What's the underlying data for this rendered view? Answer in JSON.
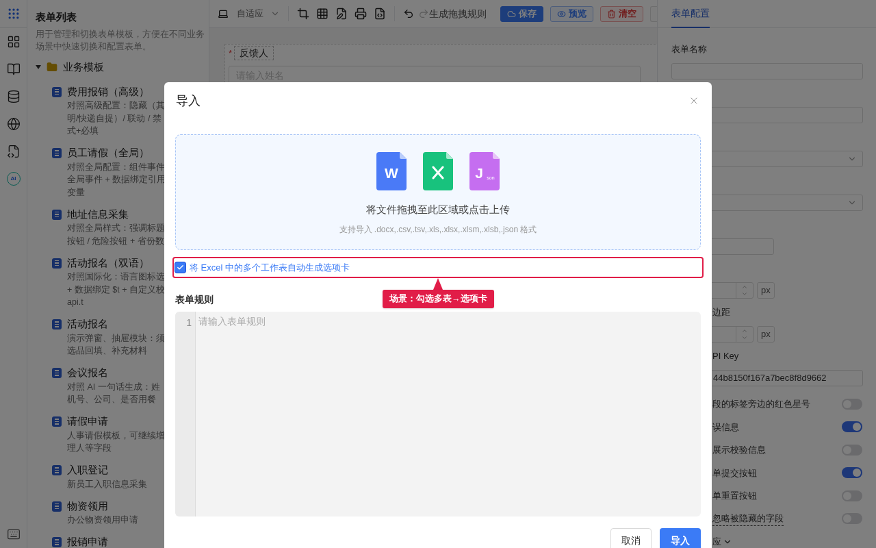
{
  "rail": {
    "ai_badge": "AI"
  },
  "sidebar": {
    "title": "表单列表",
    "description": "用于管理和切换表单模板，方便在不同业务场景中快速切换和配置表单。",
    "folder": {
      "label": "业务模板",
      "expanded": true,
      "children": [
        {
          "title": "费用报销（高级）",
          "lines": [
            "对照高级配置：隐藏（其",
            "明/快递自提）/ 联动 / 禁",
            "式+必填"
          ]
        },
        {
          "title": "员工请假（全局）",
          "lines": [
            "对照全局配置：组件事件",
            "全局事件 + 数据绑定引用",
            "变量"
          ]
        },
        {
          "title": "地址信息采集",
          "lines": [
            "对照全局样式：强调标题",
            "按钮 / 危险按钮 + 省份数"
          ]
        },
        {
          "title": "活动报名（双语）",
          "lines": [
            "对照国际化：语言图标选",
            "+ 数据绑定 $t + 自定义校",
            "api.t"
          ]
        },
        {
          "title": "活动报名",
          "lines": [
            "演示弹窗、抽屉模块：须",
            "选品回填、补充材料"
          ]
        },
        {
          "title": "会议报名",
          "lines": [
            "对照 AI 一句话生成：姓",
            "机号、公司、是否用餐"
          ]
        },
        {
          "title": "请假申请",
          "lines": [
            "人事请假模板，可继续增",
            "理人等字段"
          ]
        },
        {
          "title": "入职登记",
          "lines": [
            "新员工入职信息采集"
          ]
        },
        {
          "title": "物资领用",
          "lines": [
            "办公物资领用申请"
          ]
        },
        {
          "title": "报销申请"
        }
      ]
    }
  },
  "toolbar": {
    "device_mode": "自适应",
    "generate_label": "生成拖拽规则",
    "buttons": [
      {
        "kind": "save",
        "label": "保存"
      },
      {
        "kind": "preview",
        "label": "预览"
      },
      {
        "kind": "clear",
        "label": "清空"
      }
    ]
  },
  "canvas": {
    "field": {
      "label": "反馈人",
      "required_mark": "*",
      "placeholder": "请输入姓名"
    }
  },
  "config_panel": {
    "tabs": [
      {
        "label": "表单配置",
        "selected": true
      }
    ],
    "groups": [
      {
        "label": "表单名称",
        "kind": "input"
      },
      {
        "kind": "input"
      },
      {
        "kind": "select"
      },
      {
        "kind": "select"
      },
      {
        "kind": "short_input"
      },
      {
        "kind": "number",
        "unit": "px"
      },
      {
        "label": "边距",
        "kind": "number",
        "unit": "px"
      },
      {
        "label": "PI Key",
        "kind": "input",
        "value": "44b8150f167a7bec8f8d9662"
      }
    ],
    "switches": [
      {
        "label": "段的标签旁边的红色星号",
        "on": false,
        "hint": false
      },
      {
        "label": "误信息",
        "on": true,
        "hint": false
      },
      {
        "label": "展示校验信息",
        "on": false,
        "hint": false
      },
      {
        "label": "单提交按钮",
        "on": true,
        "hint": false
      },
      {
        "label": "单重置按钮",
        "on": false,
        "hint": false
      },
      {
        "label": "忽略被隐藏的字段",
        "on": false,
        "hint": true
      }
    ],
    "collapse": {
      "label": "应",
      "expanded": false
    }
  },
  "dialog": {
    "title": "导入",
    "file_icons": [
      {
        "kind": "word",
        "mark": "W"
      },
      {
        "kind": "excel"
      },
      {
        "kind": "json",
        "mark": "J",
        "sub": "son"
      }
    ],
    "upload_text": "将文件拖拽至此区域或点击上传",
    "upload_hint": "支持导入 .docx,.csv,.tsv,.xls,.xlsx,.xlsm,.xlsb,.json 格式",
    "checkbox": {
      "label": "将 Excel 中的多个工作表自动生成选项卡",
      "checked": true
    },
    "callout": "场景：勾选多表→选项卡",
    "rules_label": "表单规则",
    "line_number": "1",
    "rules_placeholder": "请输入表单规则",
    "buttons": [
      {
        "kind": "cancel",
        "label": "取消"
      },
      {
        "kind": "confirm",
        "label": "导入"
      }
    ]
  }
}
